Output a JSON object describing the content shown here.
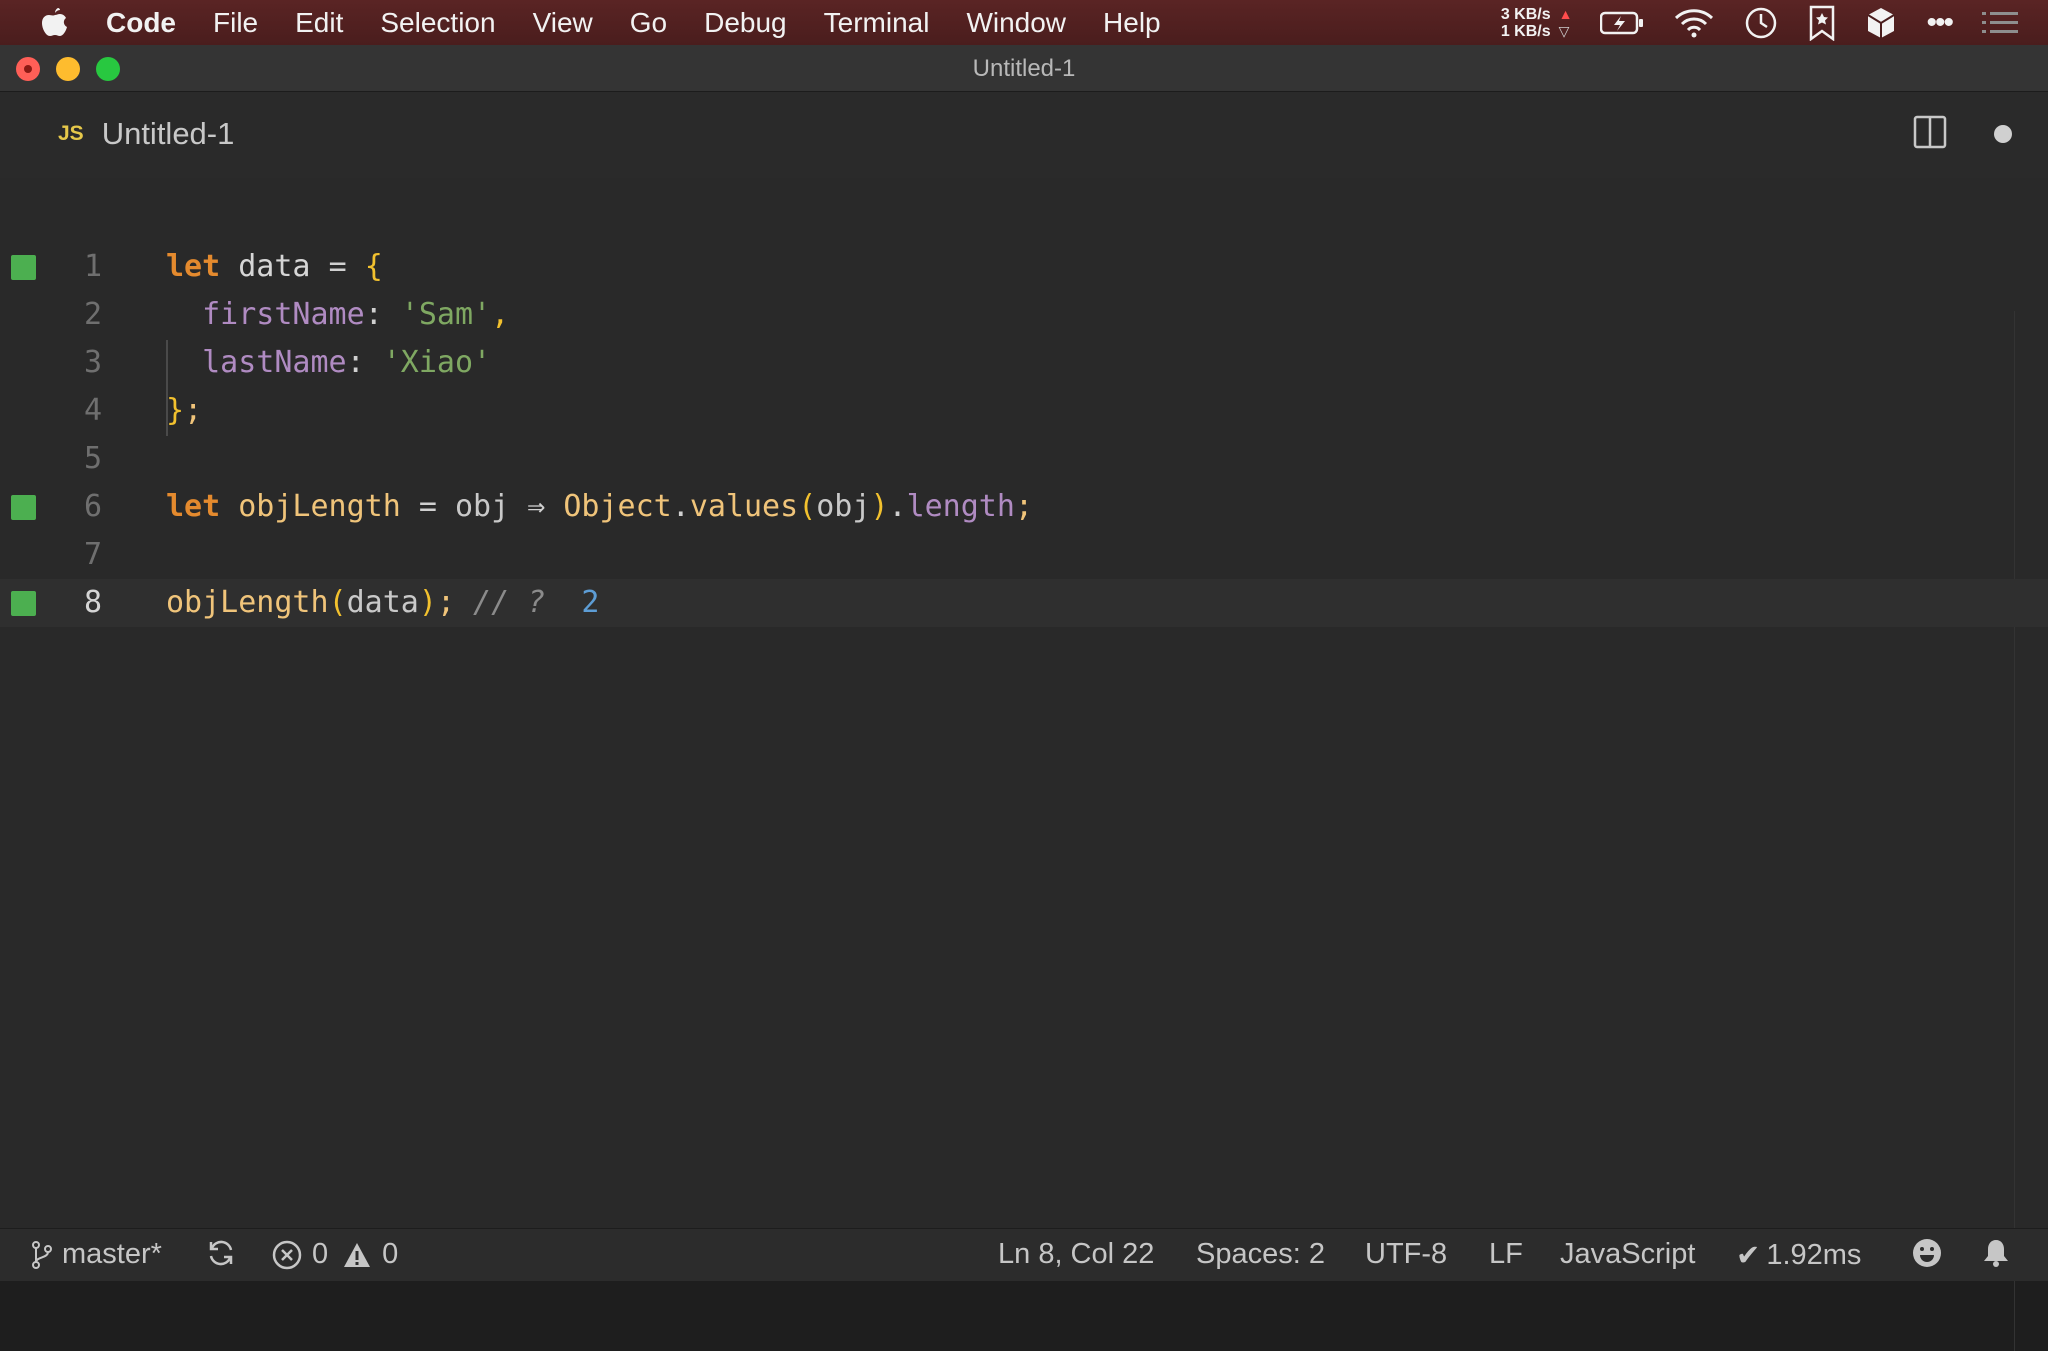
{
  "menubar": {
    "items": [
      "Code",
      "File",
      "Edit",
      "Selection",
      "View",
      "Go",
      "Debug",
      "Terminal",
      "Window",
      "Help"
    ],
    "net_up": "3 KB/s",
    "net_down": "1 KB/s"
  },
  "window": {
    "title": "Untitled-1"
  },
  "tab": {
    "badge": "JS",
    "label": "Untitled-1"
  },
  "editor": {
    "lines": [
      {
        "number": "1",
        "text": "let data = {",
        "marked": true
      },
      {
        "number": "2",
        "text": "  firstName: 'Sam',",
        "marked": false
      },
      {
        "number": "3",
        "text": "  lastName: 'Xiao'",
        "marked": false
      },
      {
        "number": "4",
        "text": "};",
        "marked": false
      },
      {
        "number": "5",
        "text": "",
        "marked": false
      },
      {
        "number": "6",
        "text": "let objLength = obj ⇒ Object.values(obj).length;",
        "marked": true
      },
      {
        "number": "7",
        "text": "",
        "marked": false
      },
      {
        "number": "8",
        "text": "objLength(data); // ?  2",
        "marked": true
      }
    ],
    "current_line": "8"
  },
  "tokens": {
    "l1_kw": "let",
    "l1_var": " data ",
    "l1_op": "= ",
    "l1_brace": "{",
    "l2_prop": "  firstName",
    "l2_punc": ": ",
    "l2_str": "'Sam'",
    "l2_comma": ",",
    "l3_prop": "  lastName",
    "l3_punc": ": ",
    "l3_str": "'Xiao'",
    "l4_brace": "}",
    "l4_semi": ";",
    "l6_kw": "let",
    "l6_var": " objLength ",
    "l6_op": "= ",
    "l6_param": "obj ",
    "l6_arrow": "⇒ ",
    "l6_obj": "Object",
    "l6_dot": ".",
    "l6_fn": "values",
    "l6_po": "(",
    "l6_arg": "obj",
    "l6_pc": ")",
    "l6_dot2": ".",
    "l6_prop": "length",
    "l6_semi": ";",
    "l8_fn": "objLength",
    "l8_po": "(",
    "l8_arg": "data",
    "l8_pc": ")",
    "l8_semi": ";",
    "l8_cmt": " // ?",
    "l8_num": "  2"
  },
  "statusbar": {
    "branch": "master*",
    "errors": "0",
    "warnings": "0",
    "position": "Ln 8, Col 22",
    "spaces": "Spaces: 2",
    "encoding": "UTF-8",
    "eol": "LF",
    "language": "JavaScript",
    "timing": "1.92ms"
  },
  "colors": {
    "menubar": "#4a1d1d",
    "editor_bg": "#292929",
    "keyword": "#e48a2e",
    "string": "#7fa862",
    "property": "#b08bc2",
    "number": "#5d9dd5",
    "gutter_mark": "#4caf50"
  },
  "icons": [
    "apple-icon",
    "upload-arrow-icon",
    "download-arrow-icon",
    "battery-icon",
    "wifi-icon",
    "clock-icon",
    "bookmark-icon",
    "cube-icon",
    "more-icon",
    "list-icon",
    "split-editor-icon",
    "git-branch-icon",
    "sync-icon",
    "error-icon",
    "warning-icon",
    "check-icon",
    "smiley-icon",
    "bell-icon"
  ]
}
